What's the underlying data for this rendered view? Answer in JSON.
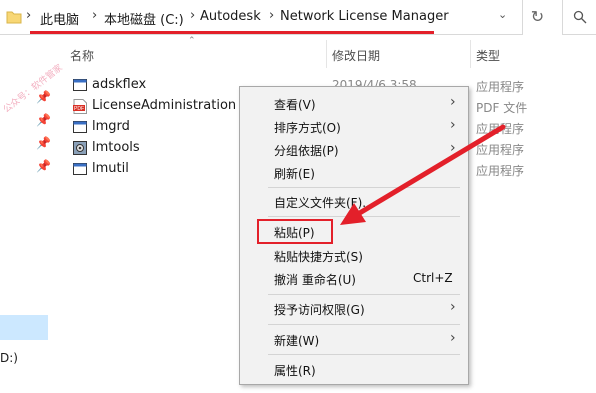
{
  "address": {
    "crumbs": [
      "此电脑",
      "本地磁盘 (C:)",
      "Autodesk",
      "Network License Manager"
    ],
    "refresh_icon": "refresh-icon",
    "search_icon": "search-icon"
  },
  "columns": {
    "name": "名称",
    "date": "修改日期",
    "type": "类型"
  },
  "files": [
    {
      "name": "adskflex",
      "date": "2019/4/6 3:58",
      "type": "应用程序",
      "icon": "exe-icon"
    },
    {
      "name": "LicenseAdministration",
      "date": "",
      "type": "PDF 文件",
      "icon": "pdf-icon"
    },
    {
      "name": "lmgrd",
      "date": "",
      "type": "应用程序",
      "icon": "exe-icon"
    },
    {
      "name": "lmtools",
      "date": "",
      "type": "应用程序",
      "icon": "tools-icon"
    },
    {
      "name": "lmutil",
      "date": "",
      "type": "应用程序",
      "icon": "exe-icon"
    }
  ],
  "left": {
    "drive_label": "D:)"
  },
  "watermark": "公众号：软件管家",
  "menu": {
    "view": "查看(V)",
    "sort": "排序方式(O)",
    "group": "分组依据(P)",
    "refresh": "刷新(E)",
    "customize": "自定义文件夹(F)...",
    "paste": "粘贴(P)",
    "paste_shortcut": "粘贴快捷方式(S)",
    "undo": "撤消 重命名(U)",
    "undo_shortcut": "Ctrl+Z",
    "access": "授予访问权限(G)",
    "new": "新建(W)",
    "properties": "属性(R)"
  },
  "colors": {
    "highlight": "#e3202a",
    "selection": "#cce8ff"
  }
}
